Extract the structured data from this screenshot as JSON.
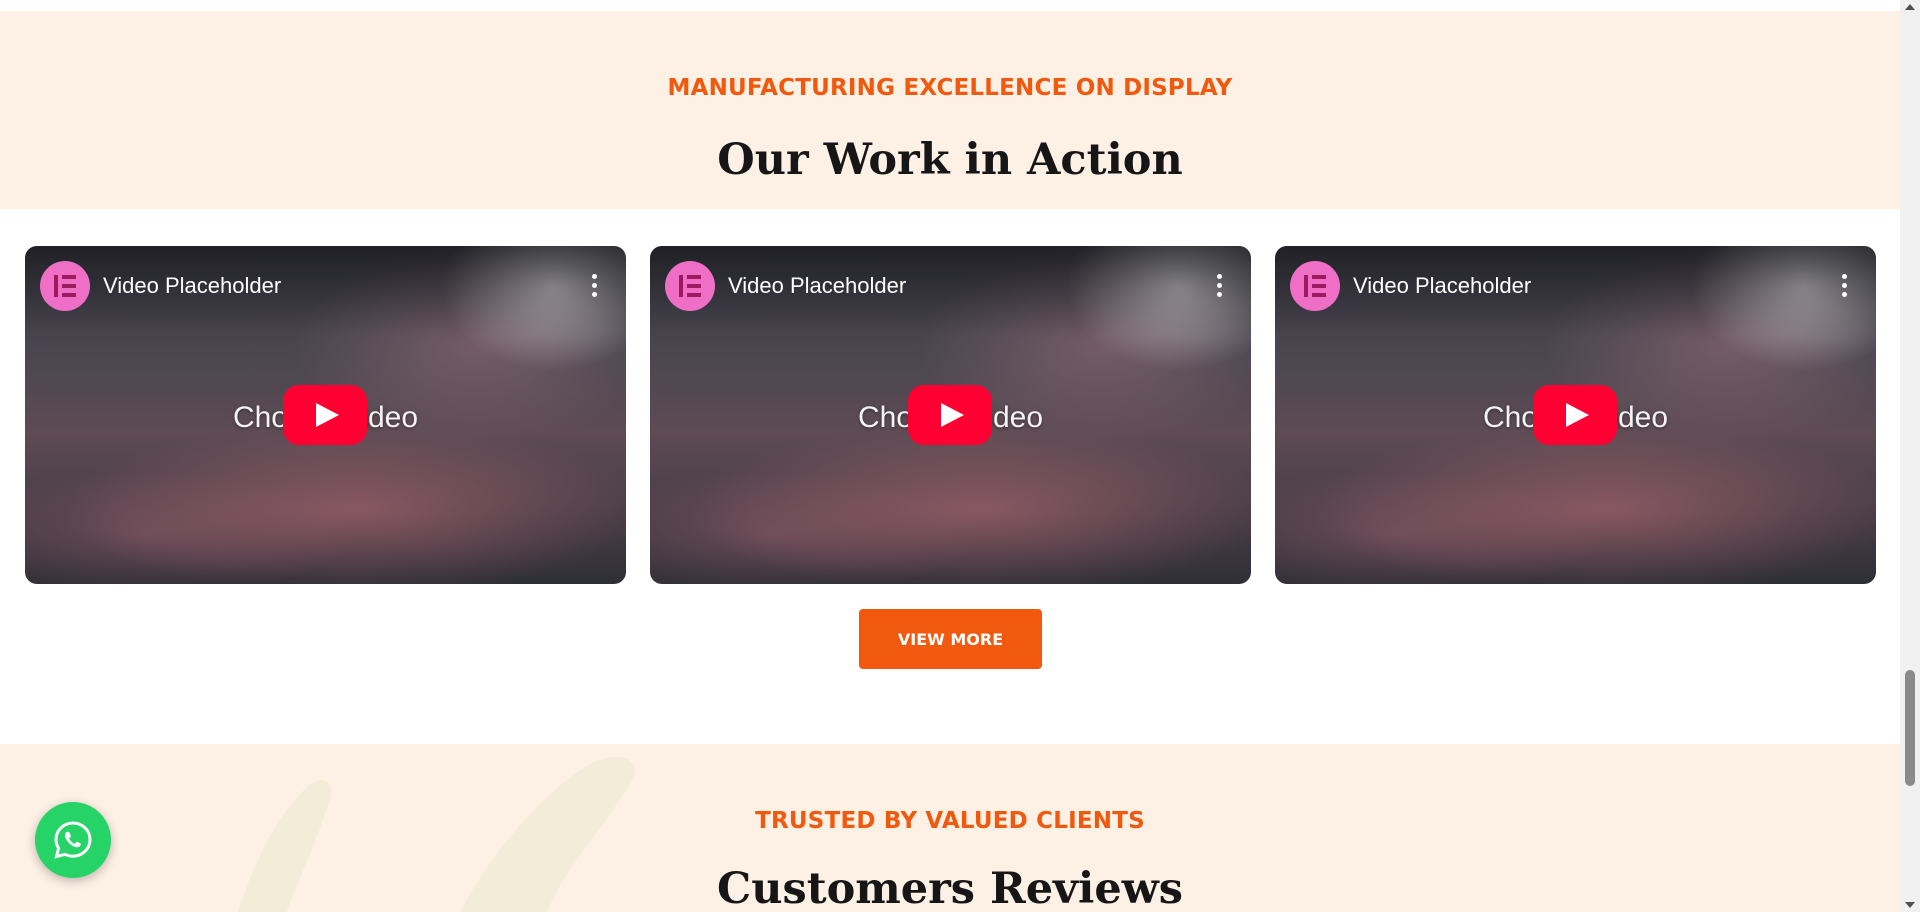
{
  "work_section": {
    "eyebrow": "MANUFACTURING EXCELLENCE ON DISPLAY",
    "heading": "Our Work in Action"
  },
  "videos": [
    {
      "title": "Video Placeholder",
      "caption": "Choos   r video",
      "logo_icon": "elementor-logo-icon",
      "menu_icon": "more-vertical-icon",
      "play_icon": "youtube-play-icon"
    },
    {
      "title": "Video Placeholder",
      "caption": "Choos   r video",
      "logo_icon": "elementor-logo-icon",
      "menu_icon": "more-vertical-icon",
      "play_icon": "youtube-play-icon"
    },
    {
      "title": "Video Placeholder",
      "caption": "Choos   r video",
      "logo_icon": "elementor-logo-icon",
      "menu_icon": "more-vertical-icon",
      "play_icon": "youtube-play-icon"
    }
  ],
  "view_more_button": "VIEW MORE",
  "reviews_section": {
    "eyebrow": "TRUSTED BY VALUED CLIENTS",
    "heading": "Customers Reviews"
  },
  "floating": {
    "whatsapp_icon": "whatsapp-icon"
  },
  "colors": {
    "accent": "#f0590e",
    "section_bg": "#fdf0e5",
    "heading": "#161616",
    "play_button": "#ff0033",
    "whatsapp": "#25d366",
    "elementor_badge": "#f06fc6"
  }
}
